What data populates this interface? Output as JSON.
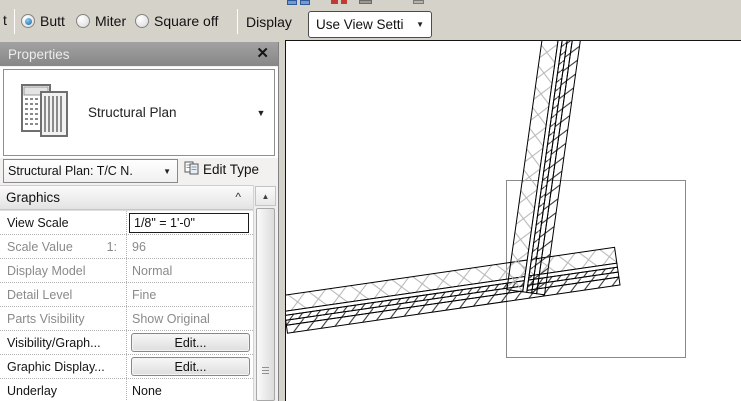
{
  "options_bar": {
    "clipped_left_text": "t",
    "join_type_radios": [
      {
        "label": "Butt",
        "selected": true
      },
      {
        "label": "Miter",
        "selected": false
      },
      {
        "label": "Square off",
        "selected": false
      }
    ],
    "display_label": "Display",
    "display_dropdown": {
      "value": "Use View Setti",
      "arrow_glyph": "▼"
    }
  },
  "properties_panel": {
    "title": "Properties",
    "close_glyph": "✕",
    "type_selector": {
      "label": "Structural Plan",
      "arrow_glyph": "▼"
    },
    "instance_dropdown": {
      "value": "Structural Plan: T/C N.",
      "arrow_glyph": "▼"
    },
    "edit_type_label": "Edit Type",
    "graphics_section": {
      "title": "Graphics",
      "collapse_glyph": "^"
    },
    "rows": [
      {
        "label": "View Scale",
        "value": "1/8\" = 1'-0\"",
        "kind": "input"
      },
      {
        "label": "Scale Value",
        "suffix": "1:",
        "value": "96",
        "kind": "disabled"
      },
      {
        "label": "Display Model",
        "value": "Normal",
        "kind": "disabled"
      },
      {
        "label": "Detail Level",
        "value": "Fine",
        "kind": "disabled"
      },
      {
        "label": "Parts Visibility",
        "value": "Show Original",
        "kind": "disabled"
      },
      {
        "label": "Visibility/Graph...",
        "value": "Edit...",
        "kind": "button"
      },
      {
        "label": "Graphic Display...",
        "value": "Edit...",
        "kind": "button"
      },
      {
        "label": "Underlay",
        "value": "None",
        "kind": "text"
      }
    ],
    "scrollbar": {
      "up_glyph": "▲"
    }
  },
  "canvas_view": {
    "description": "Structural plan view: two crosshatched walls meeting at a corner, with gray crop-region rectangle",
    "colors": {
      "toolbar_bg": "#d5d2ca",
      "panel_titlebar": "#8f8f8f",
      "radio_selected_blue": "#1767a6",
      "disabled_text": "#8a8a8a",
      "selection_box_stroke": "#8a8a8a",
      "crosshatch_gray": "#b5b5b5",
      "wall_line": "#000000"
    }
  }
}
